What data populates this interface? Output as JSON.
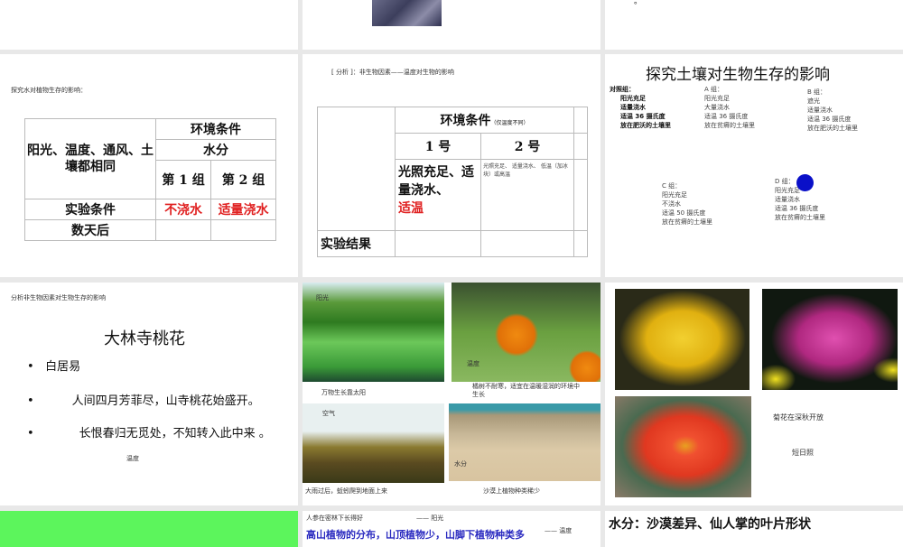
{
  "slides": {
    "s3": {
      "dot": "。"
    },
    "s4": {
      "subtitle": "探究水对植物生存的影响：",
      "same": "阳光、温度、通风、土壤都相同",
      "env": "环境条件",
      "water": "水分",
      "g1": "第 1 组",
      "g2": "第 2 组",
      "cond": "实验条件",
      "c1": "不浇水",
      "c2": "适量浇水",
      "after": "数天后"
    },
    "s5": {
      "subtitle": "[ 分析 ]：非生物因素——温度对生物的影响",
      "env": "环境条件",
      "env_note": "（仅温度不同）",
      "n1": "1 号",
      "n2": "2 号",
      "c1a": "光照充足、适量浇水、",
      "c1b": "适温",
      "c2": "光照充足、 适量浇水、 低温（加冰块）或高温",
      "result": "实验结果"
    },
    "s6": {
      "title": "探究土壤对生物生存的影响",
      "control": [
        "对照组：",
        "阳光充足",
        "适量浇水",
        "适温 36 摄氏度",
        "放在肥沃的土壤里"
      ],
      "a": [
        "A 组：",
        "阳光充足",
        "大量浇水",
        "适温 36 摄氏度",
        "放在贫瘠的土壤里"
      ],
      "b": [
        "B 组：",
        "遮光",
        "适量浇水",
        "适温 36 摄氏度",
        "放在肥沃的土壤里"
      ],
      "c": [
        "C 组：",
        "阳光充足",
        "不浇水",
        "适温 50 摄氏度",
        "放在贫瘠的土壤里"
      ],
      "d": [
        "D 组：",
        "阳光充足",
        "适量浇水",
        "适温 36 摄氏度",
        "放在贫瘠的土壤里"
      ],
      "dot_color": "#0a10c8"
    },
    "s7": {
      "subtitle": "分析非生物因素对生物生存的影响",
      "title": "大林寺桃花",
      "b1": "白居易",
      "b2": "人间四月芳菲尽，山寺桃花始盛开。",
      "b3": "长恨春归无觅处，不知转入此中来 。",
      "note": "温度"
    },
    "s8": {
      "p1_tag": "阳光",
      "p1_cap": "万物生长靠太阳",
      "p2_tag": "温度",
      "p2_cap": "橘树不耐寒，适宜在温暖湿润的环境中生长",
      "p3_tag": "空气",
      "p3_cap": "大雨过后，蚯蚓爬到地面上来",
      "p4_tag": "水分",
      "p4_cap": "沙漠上植物种类稀少"
    },
    "s9": {
      "cap1": "菊花在深秋开放",
      "cap2": "短日照"
    },
    "s11": {
      "line1": "人参在密林下长得好",
      "tag1": "—— 阳光",
      "line2": "高山植物的分布，山顶植物少，山脚下植物种类多",
      "tag2": "—— 温度"
    },
    "s12": {
      "title": "水分：沙漠差异、仙人掌的叶片形状"
    }
  }
}
